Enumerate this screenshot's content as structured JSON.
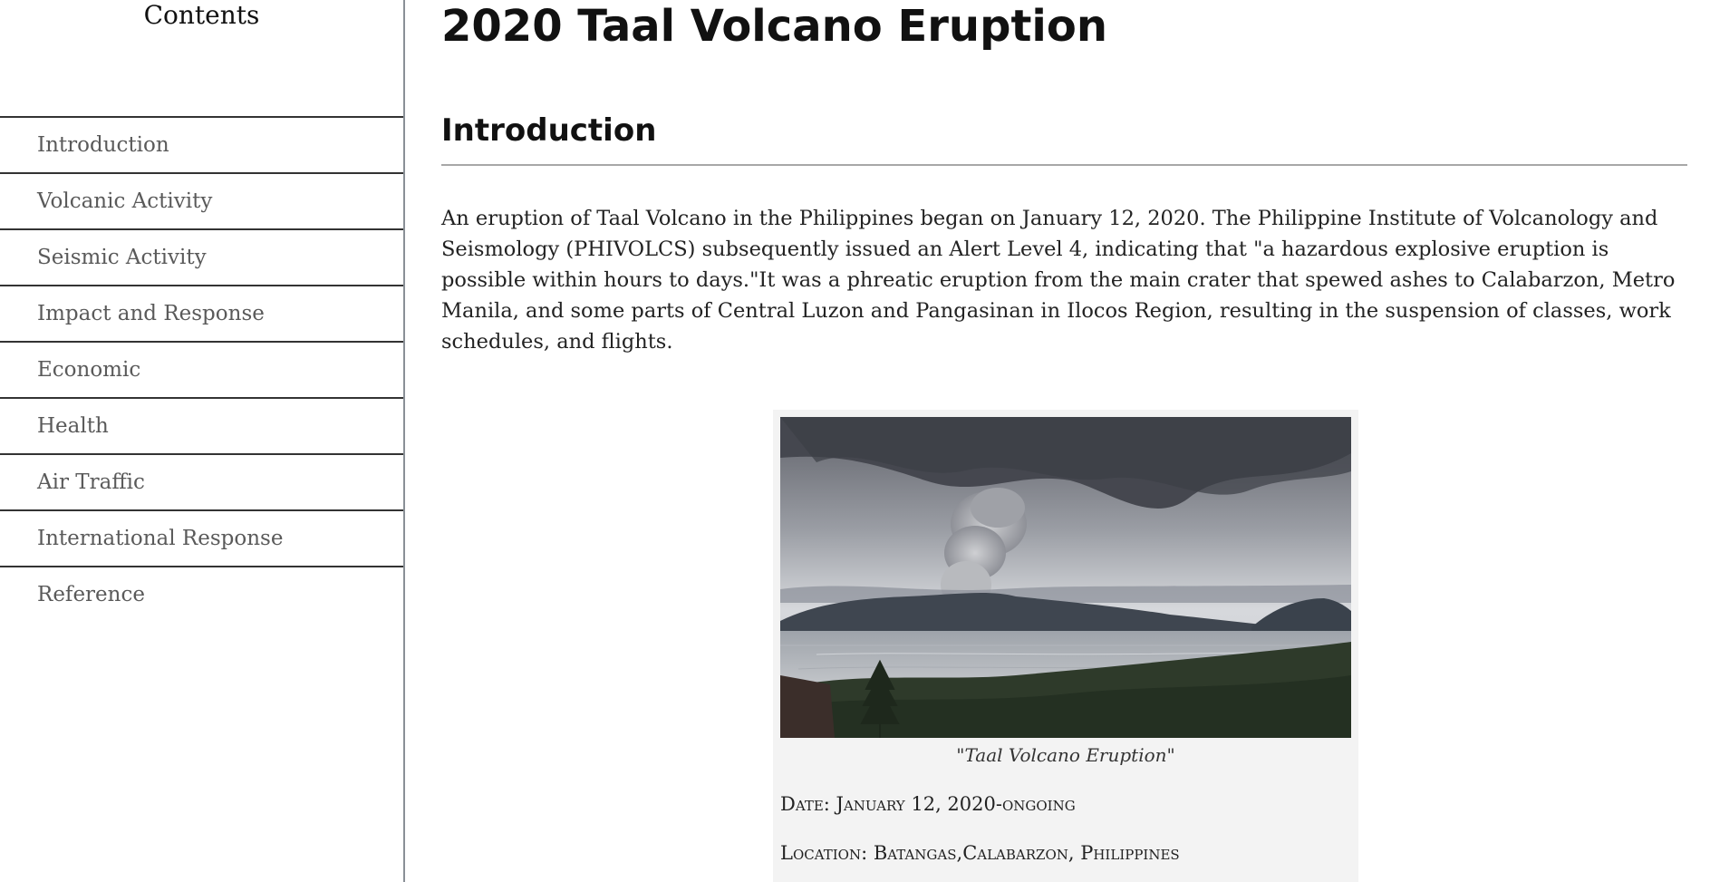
{
  "sidebar": {
    "title": "Contents",
    "items": [
      {
        "label": "Introduction"
      },
      {
        "label": "Volcanic Activity"
      },
      {
        "label": "Seismic Activity"
      },
      {
        "label": "Impact and Response"
      },
      {
        "label": "Economic"
      },
      {
        "label": "Health"
      },
      {
        "label": "Air Traffic"
      },
      {
        "label": "International Response"
      },
      {
        "label": "Reference"
      }
    ]
  },
  "main": {
    "title": "2020 Taal Volcano Eruption",
    "section_heading": "Introduction",
    "paragraph": "An eruption of Taal Volcano in the Philippines began on January 12, 2020. The Philippine Institute of Volcanology and Seismology (PHIVOLCS) subsequently issued an Alert Level 4, indicating that \"a hazardous explosive eruption is possible within hours to days.\"It was a phreatic eruption from the main crater that spewed ashes to Calabarzon, Metro Manila, and some parts of Central Luzon and Pangasinan in Ilocos Region, resulting in the suspension of classes, work schedules, and flights.",
    "figure": {
      "caption": "\"Taal Volcano Eruption\"",
      "date": "Date: January 12, 2020-ongoing",
      "location": "Location: Batangas,Calabarzon, Philippines"
    }
  },
  "colors": {
    "sidebar_border": "#8a9096",
    "nav_divider": "#333333",
    "nav_text": "#5a5a5a",
    "rule": "#a7a7a7",
    "figure_bg": "#f3f3f3"
  }
}
